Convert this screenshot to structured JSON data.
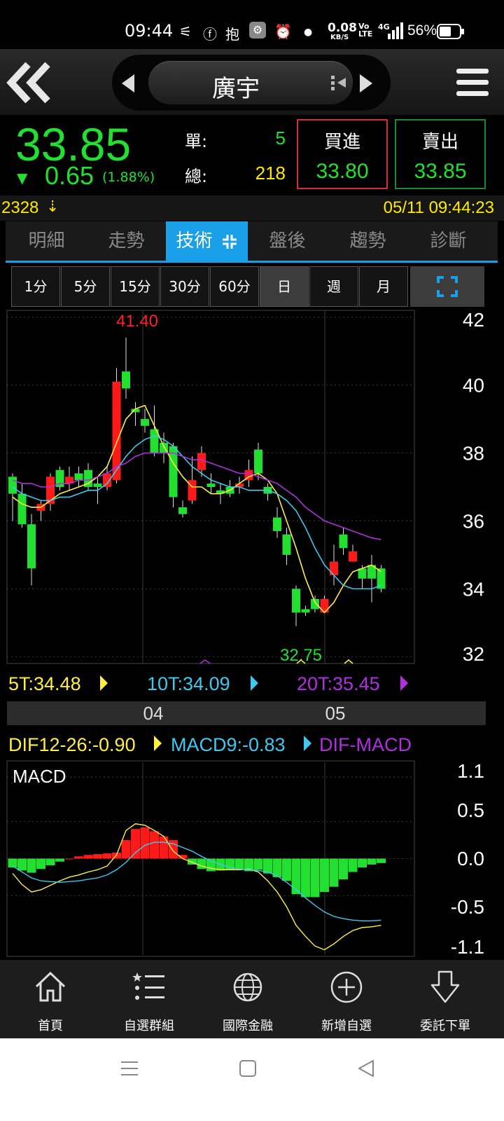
{
  "status": {
    "time": "09:44",
    "net_speed": "0.08",
    "net_unit": "KB/S",
    "battery": "56%",
    "volte": "Vo\nLTE",
    "sig": "4G"
  },
  "header": {
    "stock_name": "廣宇"
  },
  "quote": {
    "price": "33.85",
    "change": "0.65",
    "change_pct": "(1.88%)",
    "single_label": "單:",
    "single_value": "5",
    "total_label": "總:",
    "total_value": "218",
    "buy_label": "買進",
    "buy_price": "33.80",
    "sell_label": "賣出",
    "sell_price": "33.85"
  },
  "info": {
    "volume": "2328",
    "datetime": "05/11 09:44:23"
  },
  "tabs": [
    {
      "label": "明細"
    },
    {
      "label": "走勢"
    },
    {
      "label": "技術"
    },
    {
      "label": "盤後"
    },
    {
      "label": "趨勢"
    },
    {
      "label": "診斷"
    }
  ],
  "intervals": [
    "1分",
    "5分",
    "15分",
    "30分",
    "60分",
    "日",
    "週",
    "月"
  ],
  "active_interval": "日",
  "colors": {
    "up": "#ff1a1a",
    "down": "#22e030",
    "ma5": "#ffee44",
    "ma10": "#40c8f0",
    "ma20": "#b030e0",
    "accent": "#1aa0e8"
  },
  "chart_data": [
    {
      "type": "candlestick",
      "ylim": [
        31.8,
        42.2
      ],
      "y_ticks": [
        "42",
        "40",
        "38",
        "36",
        "34",
        "32"
      ],
      "x_ticks": [
        "04",
        "05"
      ],
      "high_label": "41.40",
      "low_label": "32.75",
      "legend": [
        {
          "text": "5T:34.48",
          "color": "#ffee44"
        },
        {
          "text": "10T:34.09",
          "color": "#40c8f0"
        },
        {
          "text": "20T:35.45",
          "color": "#b030e0"
        }
      ],
      "candles": [
        [
          37.3,
          36.8,
          37.4,
          36.0
        ],
        [
          36.8,
          35.9,
          37.1,
          35.8
        ],
        [
          35.9,
          34.6,
          36.2,
          34.1
        ],
        [
          36.3,
          36.5,
          36.6,
          36.0
        ],
        [
          36.5,
          37.3,
          37.4,
          36.3
        ],
        [
          37.5,
          37.0,
          37.6,
          36.9
        ],
        [
          37.1,
          37.3,
          37.6,
          36.9
        ],
        [
          37.4,
          37.2,
          37.6,
          37.0
        ],
        [
          37.5,
          37.0,
          37.7,
          36.9
        ],
        [
          37.1,
          37.0,
          37.3,
          36.5
        ],
        [
          37.0,
          37.4,
          37.6,
          36.9
        ],
        [
          37.2,
          40.1,
          40.5,
          37.1
        ],
        [
          40.4,
          39.9,
          41.4,
          39.6
        ],
        [
          39.3,
          39.2,
          39.5,
          38.8
        ],
        [
          39.0,
          38.8,
          39.3,
          38.6
        ],
        [
          38.7,
          38.0,
          39.4,
          37.9
        ],
        [
          38.3,
          38.0,
          38.6,
          37.7
        ],
        [
          38.2,
          36.7,
          38.3,
          36.4
        ],
        [
          36.4,
          36.2,
          36.6,
          36.1
        ],
        [
          36.6,
          37.2,
          37.9,
          36.5
        ],
        [
          37.5,
          38.0,
          38.2,
          37.3
        ],
        [
          37.1,
          37.0,
          37.4,
          36.8
        ],
        [
          36.9,
          36.8,
          37.1,
          36.5
        ],
        [
          37.0,
          36.8,
          37.2,
          36.7
        ],
        [
          37.0,
          37.1,
          37.3,
          36.8
        ],
        [
          37.2,
          37.5,
          37.8,
          37.0
        ],
        [
          38.1,
          37.4,
          38.3,
          37.2
        ],
        [
          37.0,
          36.8,
          37.1,
          36.6
        ],
        [
          36.1,
          35.7,
          36.4,
          35.5
        ],
        [
          35.6,
          35.0,
          35.8,
          34.7
        ],
        [
          34.0,
          33.3,
          34.1,
          32.9
        ],
        [
          33.4,
          33.3,
          33.5,
          33.2
        ],
        [
          33.7,
          33.4,
          33.8,
          33.3
        ],
        [
          33.3,
          33.7,
          33.8,
          33.3
        ],
        [
          34.4,
          34.8,
          35.3,
          34.1
        ],
        [
          35.6,
          35.2,
          35.8,
          35.0
        ],
        [
          34.8,
          35.1,
          35.3,
          34.8
        ],
        [
          34.6,
          34.3,
          34.7,
          34.0
        ],
        [
          34.7,
          34.3,
          35.0,
          33.6
        ],
        [
          34.6,
          34.0,
          34.7,
          33.9
        ]
      ],
      "ma5": [
        36.7,
        36.5,
        36.4,
        36.4,
        36.6,
        36.8,
        36.9,
        37.0,
        37.1,
        37.3,
        37.6,
        38.3,
        39.0,
        39.3,
        39.4,
        38.8,
        38.2,
        37.7,
        37.3,
        37.0,
        37.0,
        36.8,
        36.8,
        36.9,
        37.1,
        37.3,
        37.4,
        37.2,
        36.8,
        36.0,
        35.2,
        34.3,
        33.6,
        33.3,
        33.6,
        34.1,
        34.5,
        34.6,
        34.7,
        34.5
      ],
      "ma10": [
        37.0,
        36.8,
        36.7,
        36.6,
        36.6,
        36.7,
        36.7,
        36.8,
        36.9,
        36.9,
        37.1,
        37.5,
        37.9,
        38.2,
        38.4,
        38.5,
        38.4,
        38.2,
        37.9,
        37.6,
        37.4,
        37.2,
        37.1,
        37.0,
        37.0,
        36.9,
        36.9,
        36.9,
        36.8,
        36.6,
        36.3,
        35.8,
        35.2,
        34.7,
        34.4,
        34.1,
        34.0,
        34.0,
        34.0,
        34.1
      ],
      "ma20": [
        37.2,
        37.1,
        37.1,
        37.0,
        37.0,
        37.1,
        37.1,
        37.2,
        37.2,
        37.3,
        37.4,
        37.6,
        37.7,
        37.9,
        38.0,
        38.0,
        38.0,
        38.0,
        37.9,
        37.8,
        37.8,
        37.7,
        37.6,
        37.5,
        37.4,
        37.4,
        37.3,
        37.2,
        37.1,
        36.9,
        36.7,
        36.4,
        36.2,
        36.0,
        35.9,
        35.8,
        35.7,
        35.6,
        35.5,
        35.45
      ]
    },
    {
      "type": "macd",
      "title": "MACD",
      "ylim": [
        -1.3,
        1.3
      ],
      "y_ticks": [
        "1.1",
        "0.5",
        "0.0",
        "-0.5",
        "-1.1"
      ],
      "legend": [
        {
          "text": "DIF12-26:-0.90",
          "color": "#ffee44"
        },
        {
          "text": "MACD9:-0.83",
          "color": "#40c8f0"
        },
        {
          "text": "DIF-MACD",
          "color": "#b030e0"
        }
      ],
      "hist": [
        -0.12,
        -0.16,
        -0.19,
        -0.14,
        -0.09,
        -0.04,
        0.0,
        0.03,
        0.05,
        0.06,
        0.07,
        0.08,
        0.25,
        0.4,
        0.42,
        0.37,
        0.3,
        0.25,
        0.05,
        -0.08,
        -0.14,
        -0.17,
        -0.16,
        -0.15,
        -0.14,
        -0.17,
        -0.15,
        -0.2,
        -0.25,
        -0.3,
        -0.48,
        -0.52,
        -0.52,
        -0.45,
        -0.38,
        -0.28,
        -0.18,
        -0.12,
        -0.08,
        -0.06
      ],
      "dif": [
        -0.2,
        -0.35,
        -0.45,
        -0.42,
        -0.36,
        -0.3,
        -0.25,
        -0.22,
        -0.18,
        -0.15,
        -0.1,
        0.05,
        0.38,
        0.47,
        0.45,
        0.38,
        0.3,
        0.1,
        0.0,
        -0.05,
        -0.1,
        -0.13,
        -0.15,
        -0.15,
        -0.15,
        -0.14,
        -0.18,
        -0.3,
        -0.45,
        -0.65,
        -0.9,
        -1.05,
        -1.18,
        -1.23,
        -1.15,
        -1.05,
        -0.97,
        -0.93,
        -0.92,
        -0.9
      ],
      "macd": [
        -0.1,
        -0.18,
        -0.26,
        -0.3,
        -0.31,
        -0.32,
        -0.31,
        -0.3,
        -0.28,
        -0.26,
        -0.22,
        -0.15,
        -0.05,
        0.08,
        0.18,
        0.22,
        0.22,
        0.2,
        0.15,
        0.1,
        0.03,
        -0.03,
        -0.08,
        -0.12,
        -0.14,
        -0.15,
        -0.16,
        -0.18,
        -0.23,
        -0.32,
        -0.42,
        -0.53,
        -0.63,
        -0.72,
        -0.78,
        -0.81,
        -0.83,
        -0.84,
        -0.84,
        -0.83
      ]
    }
  ]
}
